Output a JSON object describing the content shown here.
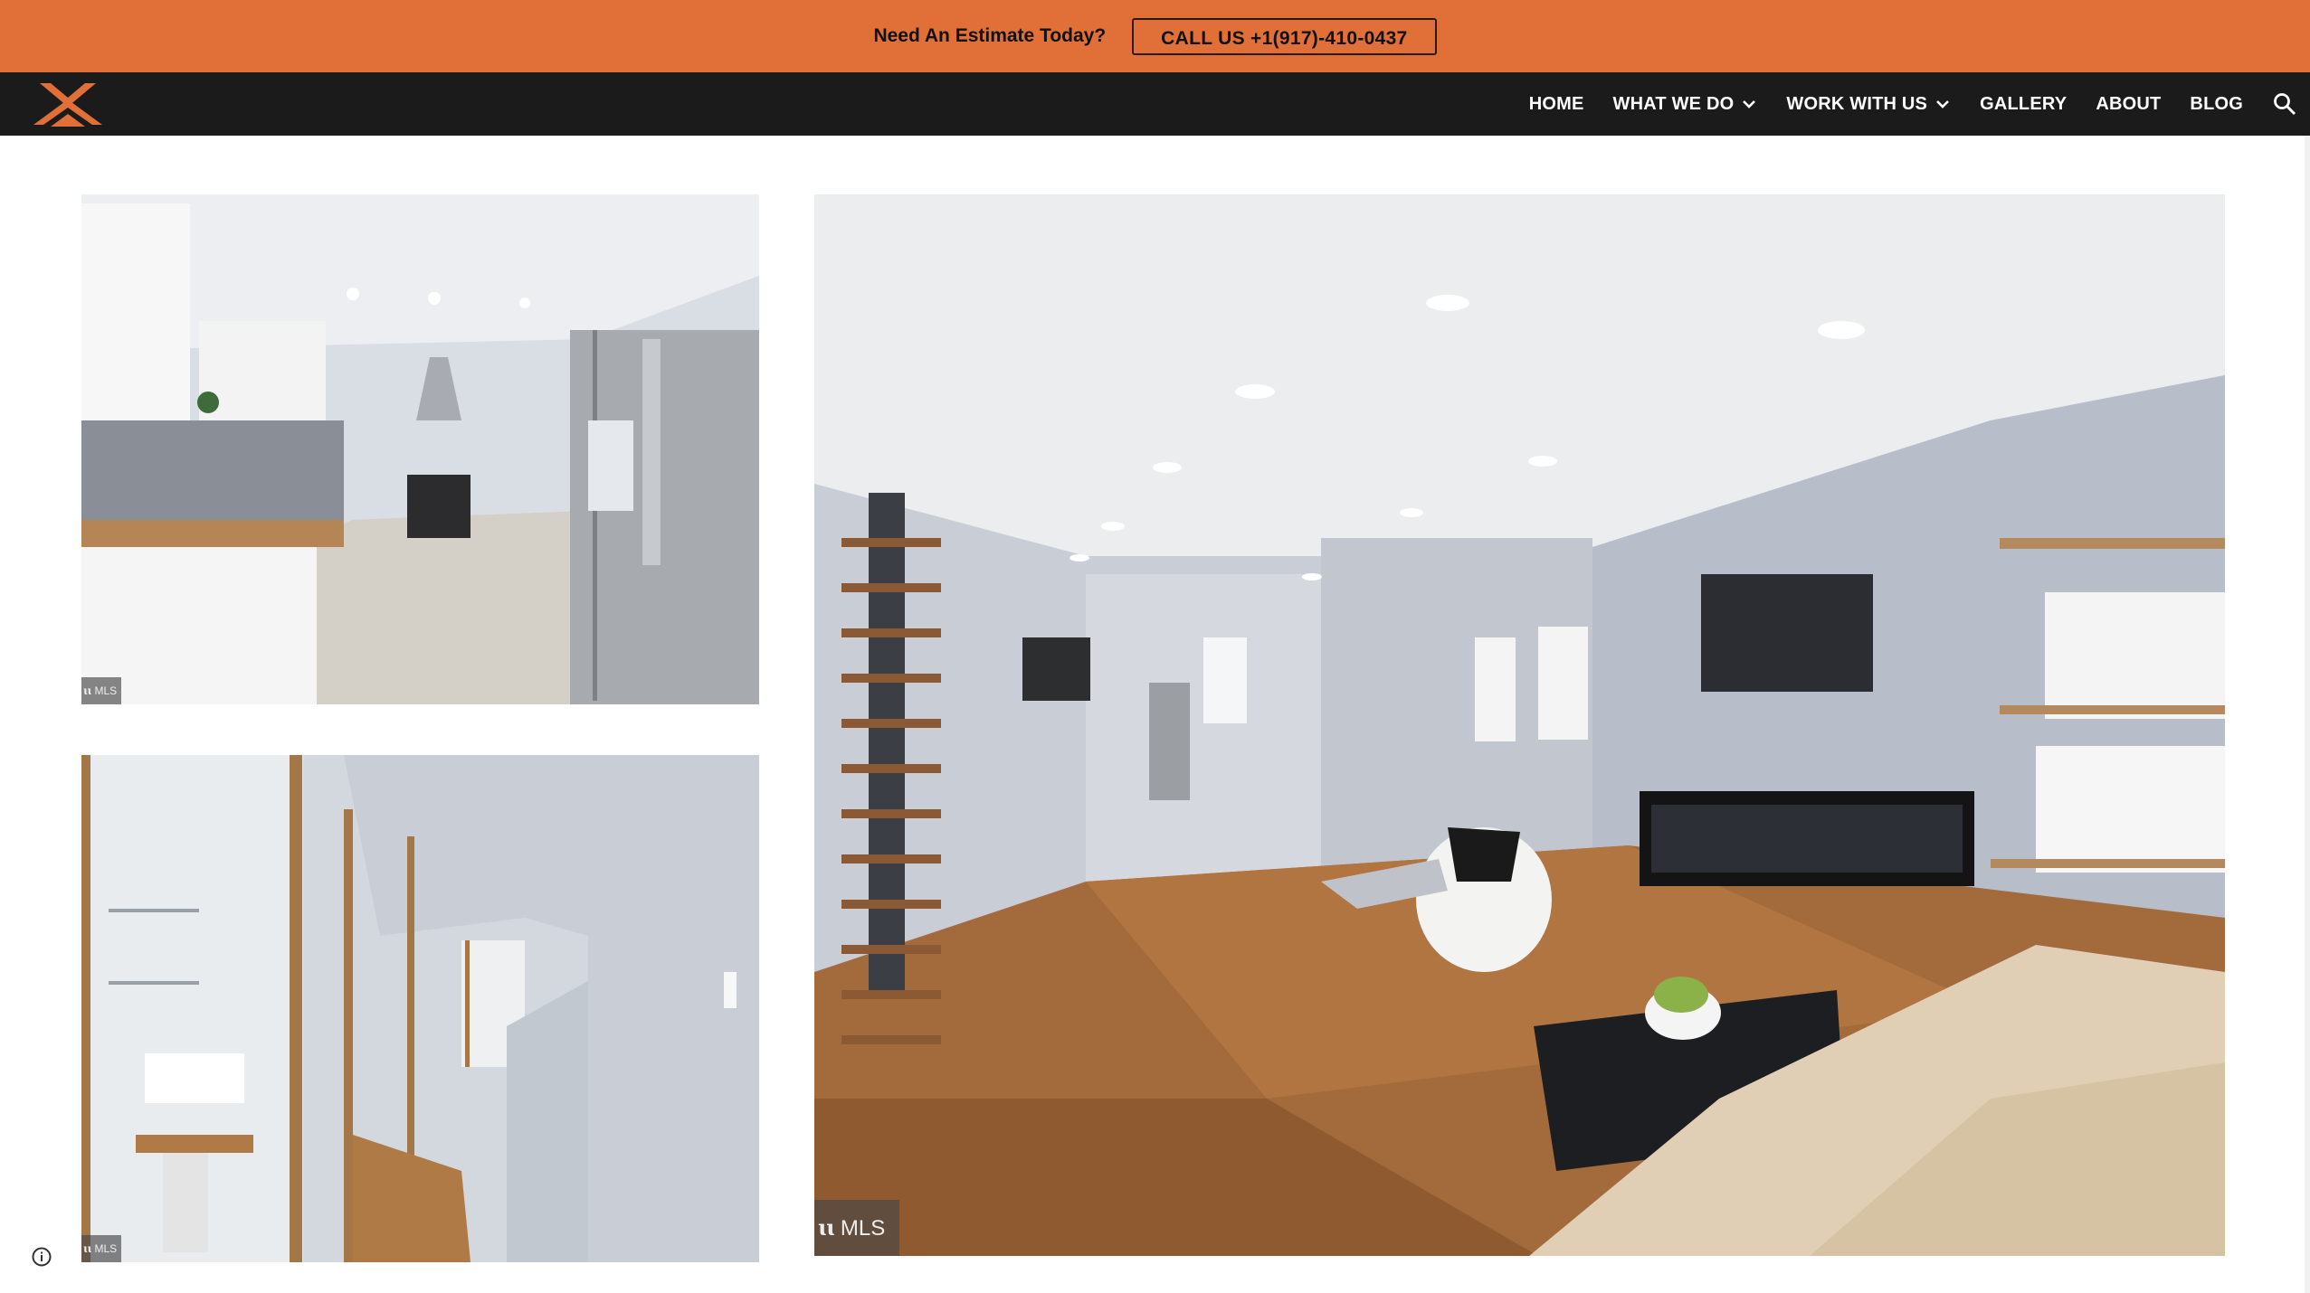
{
  "banner": {
    "text": "Need An Estimate Today?",
    "button_label": "CALL US +1(917)-410-0437",
    "background": "#e07038"
  },
  "nav": {
    "logo_icon": "roof-x-logo-icon",
    "items": [
      {
        "label": "HOME",
        "has_dropdown": false
      },
      {
        "label": "WHAT WE DO",
        "has_dropdown": true
      },
      {
        "label": "WORK WITH US",
        "has_dropdown": true
      },
      {
        "label": "GALLERY",
        "has_dropdown": false
      },
      {
        "label": "ABOUT",
        "has_dropdown": false
      },
      {
        "label": "BLOG",
        "has_dropdown": false
      }
    ],
    "search_icon": "search-icon",
    "background": "#1b1b1b"
  },
  "gallery": {
    "photos": [
      {
        "name": "kitchen-photo",
        "watermark": "MLS"
      },
      {
        "name": "hallway-bathroom-photo",
        "watermark": "MLS"
      },
      {
        "name": "living-room-photo",
        "watermark": "MLS"
      }
    ]
  },
  "footer": {
    "info_icon": "info-icon"
  }
}
